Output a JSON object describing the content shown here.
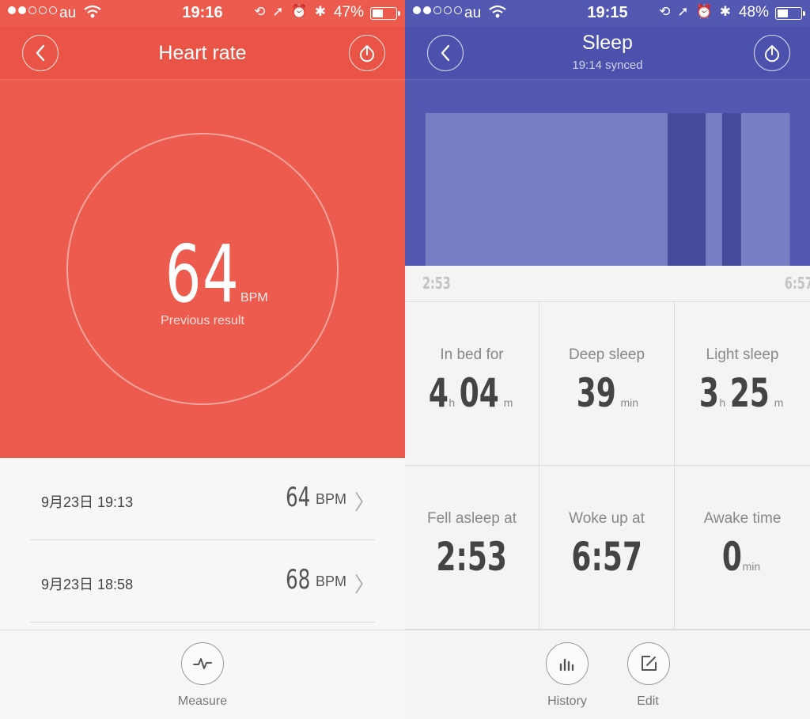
{
  "heart": {
    "status": {
      "carrier": "au",
      "time": "19:16",
      "battery_pct": "47%",
      "battery_level": 0.47
    },
    "title": "Heart rate",
    "bpm": "64",
    "bpm_unit": "BPM",
    "prev_label": "Previous result",
    "records": [
      {
        "date": "9月23日 19:13",
        "value": "64",
        "unit": "BPM"
      },
      {
        "date": "9月23日 18:58",
        "value": "68",
        "unit": "BPM"
      }
    ],
    "measure_label": "Measure"
  },
  "sleep": {
    "status": {
      "carrier": "au",
      "time": "19:15",
      "battery_pct": "48%",
      "battery_level": 0.48
    },
    "title": "Sleep",
    "synced": "19:14 synced",
    "axis_start": "2:53",
    "axis_end": "6:57",
    "chart_segments": [
      {
        "type": "light",
        "fraction": 0.665
      },
      {
        "type": "deep",
        "fraction": 0.105
      },
      {
        "type": "light",
        "fraction": 0.045
      },
      {
        "type": "deep",
        "fraction": 0.052
      },
      {
        "type": "light",
        "fraction": 0.133
      }
    ],
    "colors": {
      "light": "#777fc4",
      "deep": "#454c9b",
      "background": "#5359b3"
    },
    "stats": {
      "in_bed": {
        "label": "In bed for",
        "h": "4",
        "h_unit": "h",
        "m": "04",
        "m_unit": "m"
      },
      "deep": {
        "label": "Deep sleep",
        "v": "39",
        "unit": "min"
      },
      "light": {
        "label": "Light sleep",
        "h": "3",
        "h_unit": "h",
        "m": "25",
        "m_unit": "m"
      },
      "fell_asleep": {
        "label": "Fell asleep at",
        "v": "2:53"
      },
      "woke_up": {
        "label": "Woke up at",
        "v": "6:57"
      },
      "awake": {
        "label": "Awake time",
        "v": "0",
        "unit": "min"
      }
    },
    "history_label": "History",
    "edit_label": "Edit"
  }
}
